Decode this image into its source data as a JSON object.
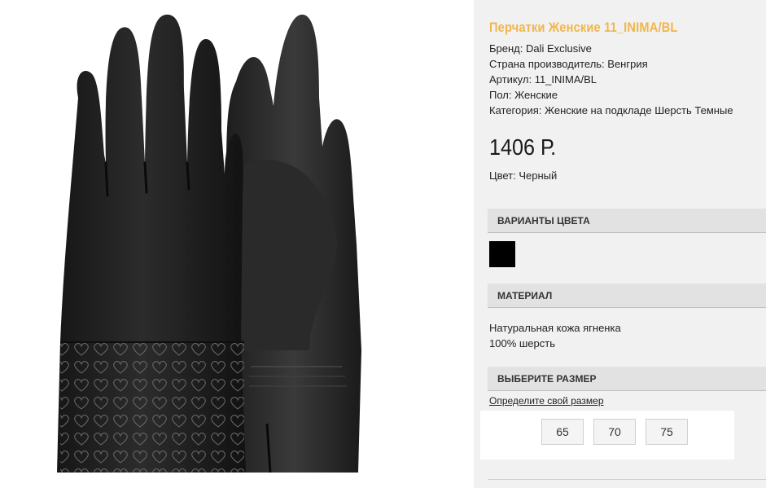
{
  "product": {
    "title": "Перчатки Женские 11_INIMA/BL",
    "properties": [
      "Бренд: Dali Exclusive",
      "Страна производитель: Венгрия",
      "Артикул: 11_INIMA/BL",
      "Пол: Женские",
      "Категория: Женские на подкладе Шерсть Темные"
    ],
    "price": "1406 Р.",
    "color_line": "Цвет: Черный",
    "image_icon": "leather-gloves-image"
  },
  "color_variants": {
    "header": "ВАРИАНТЫ ЦВЕТА",
    "swatches": [
      {
        "color": "#000000"
      }
    ]
  },
  "material": {
    "header": "МАТЕРИАЛ",
    "lines": [
      "Натуральная кожа ягненка",
      "100% шерсть"
    ]
  },
  "size": {
    "header": "ВЫБЕРИТЕ РАЗМЕР",
    "guide_link": "Определите свой размер",
    "options": [
      "65",
      "70",
      "75"
    ]
  },
  "colors": {
    "title": "#f0b64c",
    "panel_bg": "#f1f1f1",
    "header_bg": "#e2e2e2"
  }
}
